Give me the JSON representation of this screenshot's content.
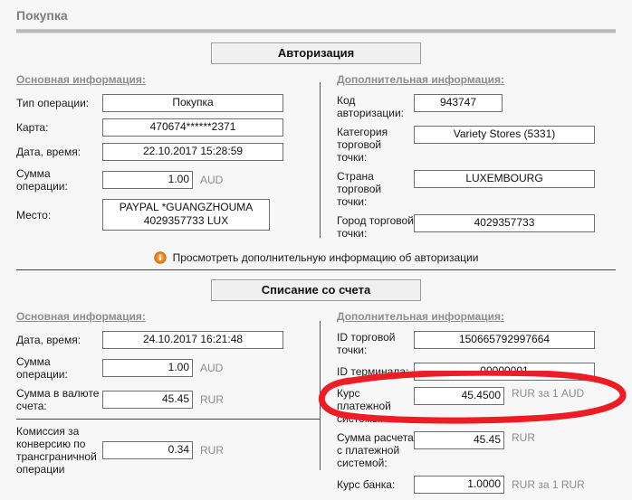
{
  "page": {
    "title": "Покупка"
  },
  "sections": [
    {
      "banner": "Авторизация",
      "left": {
        "heading": "Основная информация:",
        "fields": [
          {
            "label": "Тип операции:",
            "value": "Покупка",
            "unit": ""
          },
          {
            "label": "Карта:",
            "value": "470674******2371",
            "unit": ""
          },
          {
            "label": "Дата, время:",
            "value": "22.10.2017 15:28:59",
            "unit": ""
          },
          {
            "label": "Сумма\nоперации:",
            "value": "1.00",
            "unit": "AUD"
          },
          {
            "label": "Место:",
            "value": "PAYPAL *GUANGZHOUMA\n4029357733 LUX",
            "unit": ""
          }
        ]
      },
      "right": {
        "heading": "Дополнительная информация:",
        "fields": [
          {
            "label": "Код\nавторизации:",
            "value": "943747",
            "unit": ""
          },
          {
            "label": "Категория\nторговой точки:",
            "value": "Variety Stores (5331)",
            "unit": ""
          },
          {
            "label": "Страна\nторговой точки:",
            "value": "LUXEMBOURG",
            "unit": ""
          },
          {
            "label": "Город торговой\nточки:",
            "value": "4029357733",
            "unit": ""
          }
        ]
      },
      "info_link": {
        "icon": "info-icon",
        "text": "Просмотреть дополнительную информацию об авторизации"
      }
    },
    {
      "banner": "Списание со счета",
      "left": {
        "heading": "Основная информация:",
        "fields": [
          {
            "label": "Дата, время:",
            "value": "24.10.2017 16:21:48",
            "unit": ""
          },
          {
            "label": "Сумма\nоперации:",
            "value": "1.00",
            "unit": "AUD"
          },
          {
            "label": "Сумма в валюте\nсчета:",
            "value": "45.45",
            "unit": "RUR"
          }
        ],
        "fields_after_rule": [
          {
            "label": "Комиссия за\nконверсию по\nтрансграничной\nоперации",
            "value": "0.34",
            "unit": "RUR"
          }
        ]
      },
      "right": {
        "heading": "Дополнительная информация:",
        "fields": [
          {
            "label": "ID торговой\nточки:",
            "value": "150665792997664",
            "unit": ""
          },
          {
            "label": "ID терминала:",
            "value": "00000001",
            "unit": ""
          },
          {
            "label": "Курс платежной\nсистемы:",
            "value": "45.4500",
            "unit": "RUR за 1 AUD"
          },
          {
            "label": "Сумма расчета\nс платежной\nсистемой:",
            "value": "45.45",
            "unit": "RUR"
          },
          {
            "label": "Курс банка:",
            "value": "1.0000",
            "unit": "RUR за 1 RUR"
          }
        ]
      }
    }
  ],
  "annotation": {
    "shape": "ellipse",
    "color": "#ee1c25",
    "target": "Курс платежной системы"
  },
  "colors": {
    "background": "#f7f7f7",
    "heading": "#8d8d8d",
    "unit": "#8d8d8d",
    "field_border": "#6e6e6e",
    "banner_bg": "#f0f0f0",
    "annotation_red": "#ee1c25",
    "info_icon_orange": "#e8861e"
  }
}
